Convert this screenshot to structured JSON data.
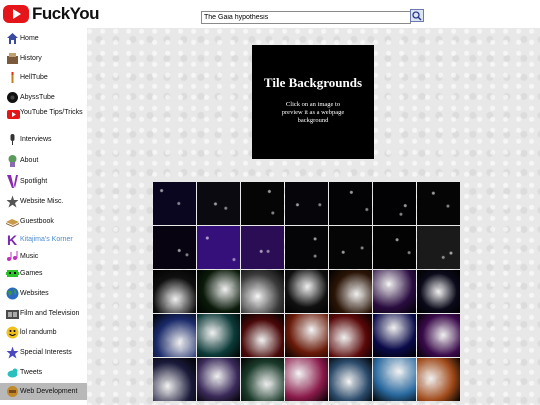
{
  "header": {
    "logo_text": "FuckYou",
    "search_value": "The Gaia hypothesis",
    "search_button_icon": "search-icon"
  },
  "sidebar": {
    "items": [
      {
        "label": "Home",
        "icon": "home-icon"
      },
      {
        "label": "History",
        "icon": "history-icon"
      },
      {
        "label": "HellTube",
        "icon": "helltube-icon"
      },
      {
        "label": "AbyssTube",
        "icon": "abysstube-icon"
      },
      {
        "label": "YouTube Tips/Tricks",
        "icon": "youtube-icon"
      },
      {
        "label": "Interviews",
        "icon": "microphone-icon"
      },
      {
        "label": "About",
        "icon": "about-icon"
      },
      {
        "label": "Spotlight",
        "icon": "spotlight-icon"
      },
      {
        "label": "Website Misc.",
        "icon": "star-icon"
      },
      {
        "label": "Guestbook",
        "icon": "guestbook-icon"
      },
      {
        "label": "Kitajima's Korner",
        "icon": "k-icon"
      },
      {
        "label": "Music",
        "icon": "music-icon"
      },
      {
        "label": "Games",
        "icon": "games-icon"
      },
      {
        "label": "Websites",
        "icon": "globe-icon"
      },
      {
        "label": "Film and Television",
        "icon": "film-icon"
      },
      {
        "label": "lol randumb",
        "icon": "smiley-icon"
      },
      {
        "label": "Special Interests",
        "icon": "star-icon"
      },
      {
        "label": "Tweets",
        "icon": "bird-icon"
      },
      {
        "label": "Web Development",
        "icon": "web-dev-icon"
      }
    ],
    "active": "Web Development"
  },
  "main": {
    "title": "Tile Backgrounds",
    "subtitle": "Click on an image to preview it as a webpage background"
  },
  "colors": {
    "logo_red": "#e4161a",
    "active_bg": "#b8b8b8",
    "panel_bg": "#000000"
  },
  "tiles": [
    [
      "#0b0620",
      "#0a0a10",
      "#050505",
      "#05050a",
      "#030305",
      "#020204",
      "#050505"
    ],
    [
      "#070310",
      "#35107a",
      "#2a0d55",
      "#050508",
      "#050505",
      "#030303",
      "#1a1a1a"
    ],
    [
      "#101010",
      "#0a1a0a",
      "#3a3a3a",
      "#101010",
      "#2a1406",
      "#2a0c40",
      "#0a0a1a"
    ],
    [
      "#1a2a6a",
      "#0b3a38",
      "#4a0808",
      "#6a1a08",
      "#5a0808",
      "#0a0a4a",
      "#3a0a4a"
    ],
    [
      "#1a1a3a",
      "#3a2a5a",
      "#1a3a2a",
      "#8a1a4a",
      "#2a4a6a",
      "#2a6aa0",
      "#a04a1a"
    ]
  ]
}
